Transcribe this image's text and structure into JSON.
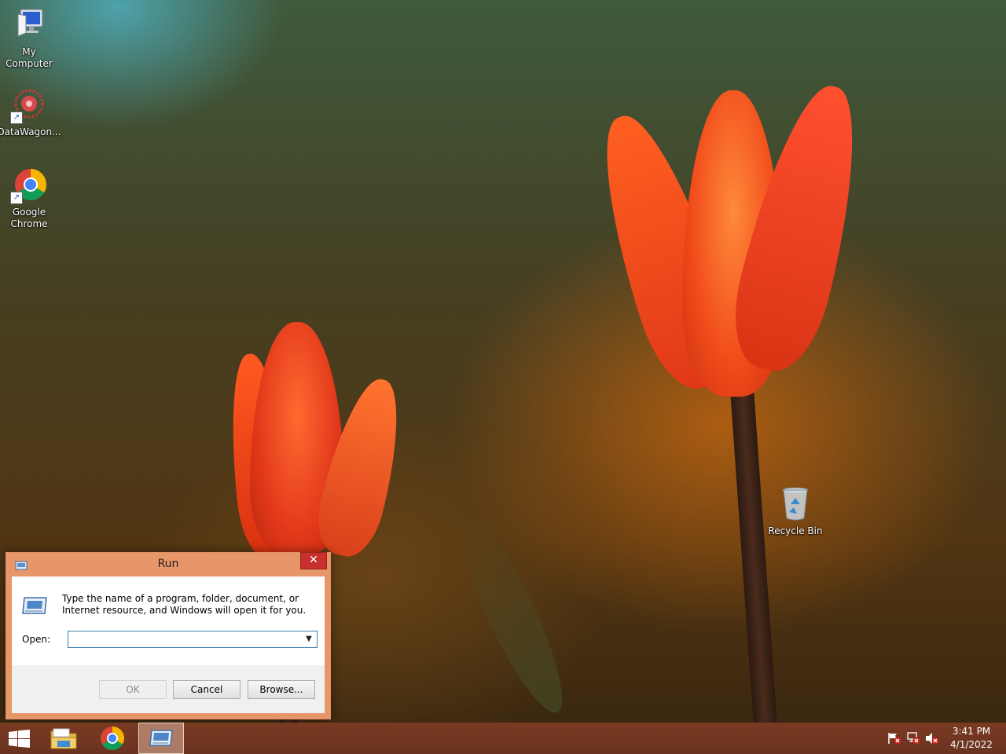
{
  "desktop": {
    "icons": [
      {
        "label": "My\nComputer",
        "icon": "computer-icon"
      },
      {
        "label": "DataWagon...",
        "icon": "datawagon-icon"
      },
      {
        "label": "Google\nChrome",
        "icon": "chrome-icon"
      },
      {
        "label": "Recycle Bin",
        "icon": "recycle-bin-icon"
      }
    ]
  },
  "run_dialog": {
    "title": "Run",
    "close_glyph": "✕",
    "description": "Type the name of a program, folder, document, or Internet resource, and Windows will open it for you.",
    "open_label": "Open:",
    "open_value": "",
    "buttons": {
      "ok": "OK",
      "cancel": "Cancel",
      "browse": "Browse..."
    },
    "ok_disabled": true
  },
  "taskbar": {
    "pinned": [
      "start-icon",
      "file-explorer-icon",
      "chrome-icon",
      "run-icon"
    ],
    "active": "run-icon",
    "tray": [
      "action-center-flag-icon",
      "network-icon",
      "speaker-muted-icon"
    ],
    "clock": {
      "time": "3:41 PM",
      "date": "4/1/2022"
    }
  },
  "colors": {
    "dialog_frame": "#e69668",
    "close_button": "#c7302c",
    "taskbar": "#6a3320"
  }
}
